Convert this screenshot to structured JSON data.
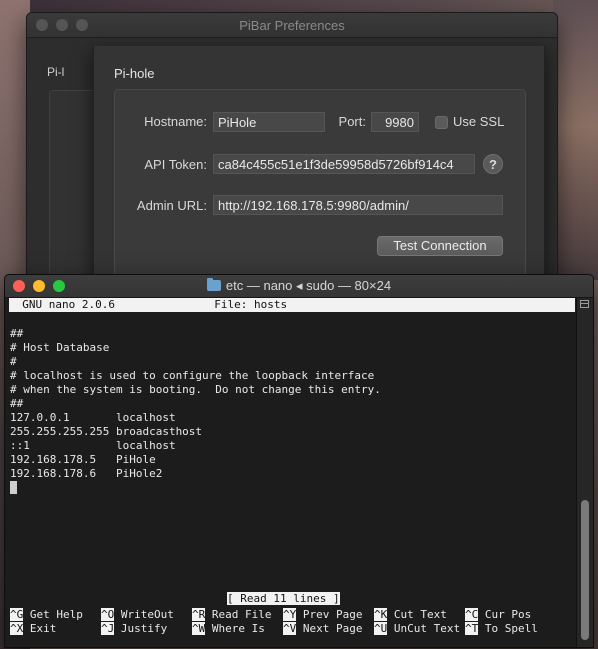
{
  "colors": {
    "close": "#ff5f57",
    "minimize": "#febc2e",
    "zoom": "#28c840"
  },
  "prefs": {
    "title": "PiBar Preferences",
    "tab_stub": "Pi-l",
    "sheet": {
      "title": "Pi-hole",
      "hostname_label": "Hostname:",
      "hostname_value": "PiHole",
      "port_label": "Port:",
      "port_value": "9980",
      "ssl_label": "Use SSL",
      "ssl_checked": false,
      "api_label": "API Token:",
      "api_value": "ca84c455c51e1f3de59958d5726bf914c4",
      "help_symbol": "?",
      "admin_label": "Admin URL:",
      "admin_value": "http://192.168.178.5:9980/admin/",
      "test_button": "Test Connection"
    }
  },
  "terminal": {
    "title": "etc — nano ◂ sudo — 80×24",
    "folder_icon": "folder-icon",
    "nano_header": "  GNU nano 2.0.6               File: hosts",
    "lines": [
      "##",
      "# Host Database",
      "#",
      "# localhost is used to configure the loopback interface",
      "# when the system is booting.  Do not change this entry.",
      "##",
      "127.0.0.1       localhost",
      "255.255.255.255 broadcasthost",
      "::1             localhost",
      "192.168.178.5   PiHole",
      "192.168.178.6   PiHole2"
    ],
    "status": "[ Read 11 lines ]",
    "shortcuts_row1": [
      {
        "key": "^G",
        "label": " Get Help  "
      },
      {
        "key": "^O",
        "label": " WriteOut  "
      },
      {
        "key": "^R",
        "label": " Read File "
      },
      {
        "key": "^Y",
        "label": " Prev Page "
      },
      {
        "key": "^K",
        "label": " Cut Text  "
      },
      {
        "key": "^C",
        "label": " Cur Pos"
      }
    ],
    "shortcuts_row2": [
      {
        "key": "^X",
        "label": " Exit      "
      },
      {
        "key": "^J",
        "label": " Justify   "
      },
      {
        "key": "^W",
        "label": " Where Is  "
      },
      {
        "key": "^V",
        "label": " Next Page "
      },
      {
        "key": "^U",
        "label": " UnCut Text"
      },
      {
        "key": "^T",
        "label": " To Spell"
      }
    ]
  }
}
